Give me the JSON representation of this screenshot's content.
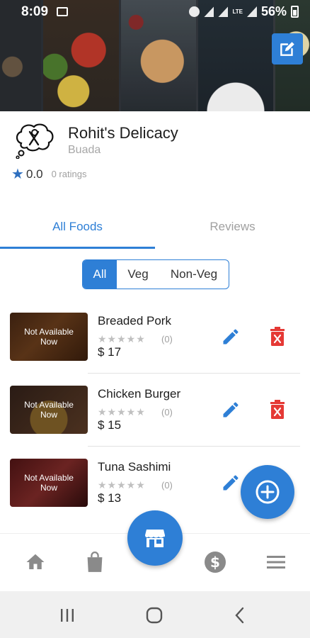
{
  "status_bar": {
    "time": "8:09",
    "battery": "56%",
    "network": "LTE"
  },
  "restaurant": {
    "name": "Rohit's Delicacy",
    "location": "Buada",
    "rating": "0.0",
    "rating_count": "0 ratings"
  },
  "tabs": [
    {
      "label": "All Foods",
      "active": true
    },
    {
      "label": "Reviews",
      "active": false
    }
  ],
  "filters": [
    {
      "label": "All",
      "active": true
    },
    {
      "label": "Veg",
      "active": false
    },
    {
      "label": "Non-Veg",
      "active": false
    }
  ],
  "foods": [
    {
      "name": "Breaded Pork",
      "availability": "Not Available Now",
      "stars": "★★★★★",
      "reviews": "(0)",
      "price": "$ 17"
    },
    {
      "name": "Chicken Burger",
      "availability": "Not Available Now",
      "stars": "★★★★★",
      "reviews": "(0)",
      "price": "$ 15"
    },
    {
      "name": "Tuna Sashimi",
      "availability": "Not Available Now",
      "stars": "★★★★★",
      "reviews": "(0)",
      "price": "$ 13"
    }
  ],
  "colors": {
    "accent": "#2e7fd6",
    "delete": "#e53935",
    "inactive": "#a0a0a0"
  },
  "icons": {
    "edit_header": "edit-square-icon",
    "logo": "restaurant-logo-icon",
    "food_edit": "pencil-icon",
    "food_delete": "trash-icon",
    "add": "plus-circle-icon",
    "store": "store-icon",
    "nav": [
      "home-icon",
      "shopping-bag-icon",
      "dollar-icon",
      "menu-icon"
    ]
  }
}
